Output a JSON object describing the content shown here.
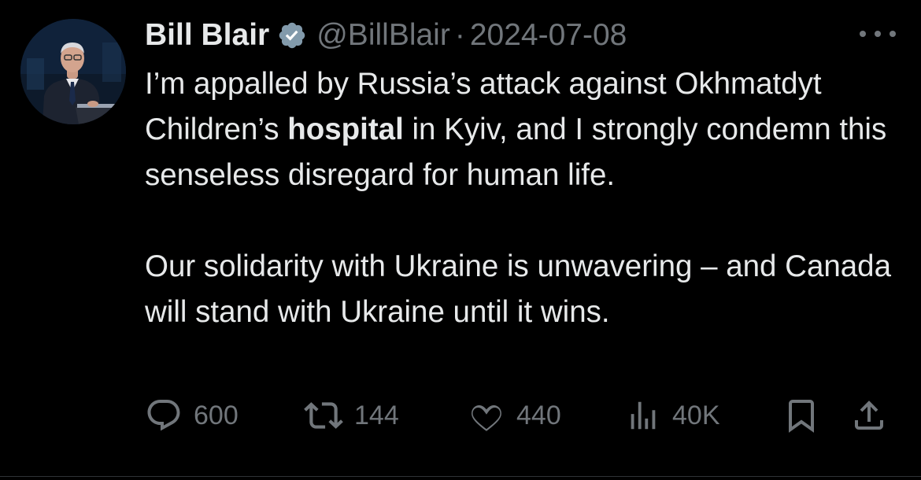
{
  "author": {
    "name": "Bill Blair",
    "handle": "@BillBlair",
    "separator": "·",
    "date": "2024-07-08",
    "verified": true,
    "avatar_icon": "profile-photo"
  },
  "tweet": {
    "paragraph1_before": "I’m appalled by Russia’s attack against Okhmatdyt Children’s ",
    "paragraph1_highlight": "hospital",
    "paragraph1_after": " in Kyiv, and I strongly condemn this senseless disregard for human life.",
    "paragraph2": "Our solidarity with Ukraine is unwavering – and Canada will stand with Ukraine until it wins."
  },
  "actions": {
    "replies": "600",
    "reposts": "144",
    "likes": "440",
    "views": "40K"
  },
  "icons": {
    "more": "more-icon",
    "reply": "reply-icon",
    "repost": "repost-icon",
    "like": "like-icon",
    "views": "views-icon",
    "bookmark": "bookmark-icon",
    "share": "share-icon",
    "verified": "verified-badge-icon"
  },
  "colors": {
    "background": "#000000",
    "text": "#e7e9ea",
    "secondary": "#71767b",
    "verified": "#829aab"
  }
}
